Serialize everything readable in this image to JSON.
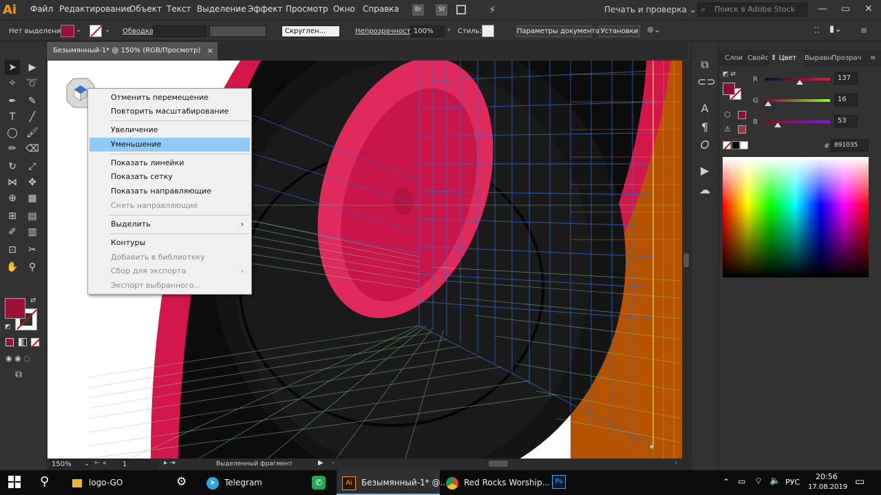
{
  "app": {
    "logo": "Ai"
  },
  "menubar": {
    "items": [
      "Файл",
      "Редактирование",
      "Объект",
      "Текст",
      "Выделение",
      "Эффект",
      "Просмотр",
      "Окно",
      "Справка"
    ],
    "bridge": "Br",
    "stock_btn": "St",
    "workspace": "Печать и проверка",
    "stock_search_placeholder": "Поиск в Adobe Stock"
  },
  "control_bar": {
    "selection_label": "Нет выделения",
    "stroke_label": "Обводка:",
    "brush_label": "Скруглен...",
    "opacity_label": "Непрозрачность:",
    "opacity_value": "100%",
    "style_label": "Стиль:",
    "doc_settings_button": "Параметры документа",
    "preferences_button": "Установки",
    "fill_color": "#9b1035"
  },
  "document_tab": {
    "title": "Безымянный-1* @ 150% (RGB/Просмотр)",
    "close": "×"
  },
  "context_menu": {
    "items": [
      {
        "label": "Отменить перемещение",
        "disabled": false
      },
      {
        "label": "Повторить масштабирование",
        "disabled": false
      },
      {
        "label": "Увеличение",
        "disabled": false
      },
      {
        "label": "Уменьшение",
        "disabled": false,
        "highlighted": true
      },
      {
        "label": "Показать линейки",
        "disabled": false
      },
      {
        "label": "Показать сетку",
        "disabled": false
      },
      {
        "label": "Показать направляющие",
        "disabled": false
      },
      {
        "label": "Снять направляющие",
        "disabled": true
      },
      {
        "label": "Выделить",
        "disabled": false,
        "submenu": true
      },
      {
        "label": "Контуры",
        "disabled": false
      },
      {
        "label": "Добавить в библиотеку",
        "disabled": true
      },
      {
        "label": "Сбор для экспорта",
        "disabled": true,
        "submenu": true
      },
      {
        "label": "Экспорт выбранного...",
        "disabled": true
      }
    ]
  },
  "statusbar": {
    "zoom": "150%",
    "page": "1",
    "status": "Выделенный фрагмент"
  },
  "color_panel": {
    "tabs": [
      "Слои",
      "Свойс",
      "Цвет",
      "Выравн",
      "Прозрач"
    ],
    "active_tab": "Цвет",
    "r_label": "R",
    "r_value": "137",
    "g_label": "G",
    "g_value": "16",
    "b_label": "B",
    "b_value": "53",
    "hex_label": "#",
    "hex_value": "891035",
    "fill_color": "#891035"
  },
  "taskbar": {
    "items": [
      "logo-GO",
      "Telegram",
      "Безымянный-1* @...",
      "Red Rocks Worship..."
    ],
    "ai_icon": "Ai",
    "ps_icon": "Ps",
    "lang": "РУС",
    "time": "20:56",
    "date": "17.08.2019"
  }
}
